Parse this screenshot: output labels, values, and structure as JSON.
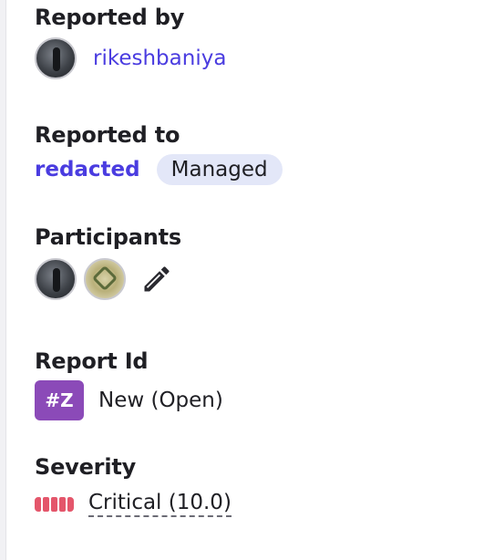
{
  "reported_by": {
    "label": "Reported by",
    "user": "rikeshbaniya"
  },
  "reported_to": {
    "label": "Reported to",
    "program": "redacted",
    "badge": "Managed"
  },
  "participants": {
    "label": "Participants",
    "icons": [
      "avatar",
      "avatar",
      "pencil-icon"
    ]
  },
  "report_id": {
    "label": "Report Id",
    "id_badge": "#Z",
    "status": "New (Open)"
  },
  "severity": {
    "label": "Severity",
    "value": "Critical (10.0)",
    "level_segments": 5,
    "color": "#e4566b"
  },
  "colors": {
    "link": "#4a3ce0",
    "badge_bg": "#8b4ab8",
    "pill_bg": "#e3e7f8"
  }
}
